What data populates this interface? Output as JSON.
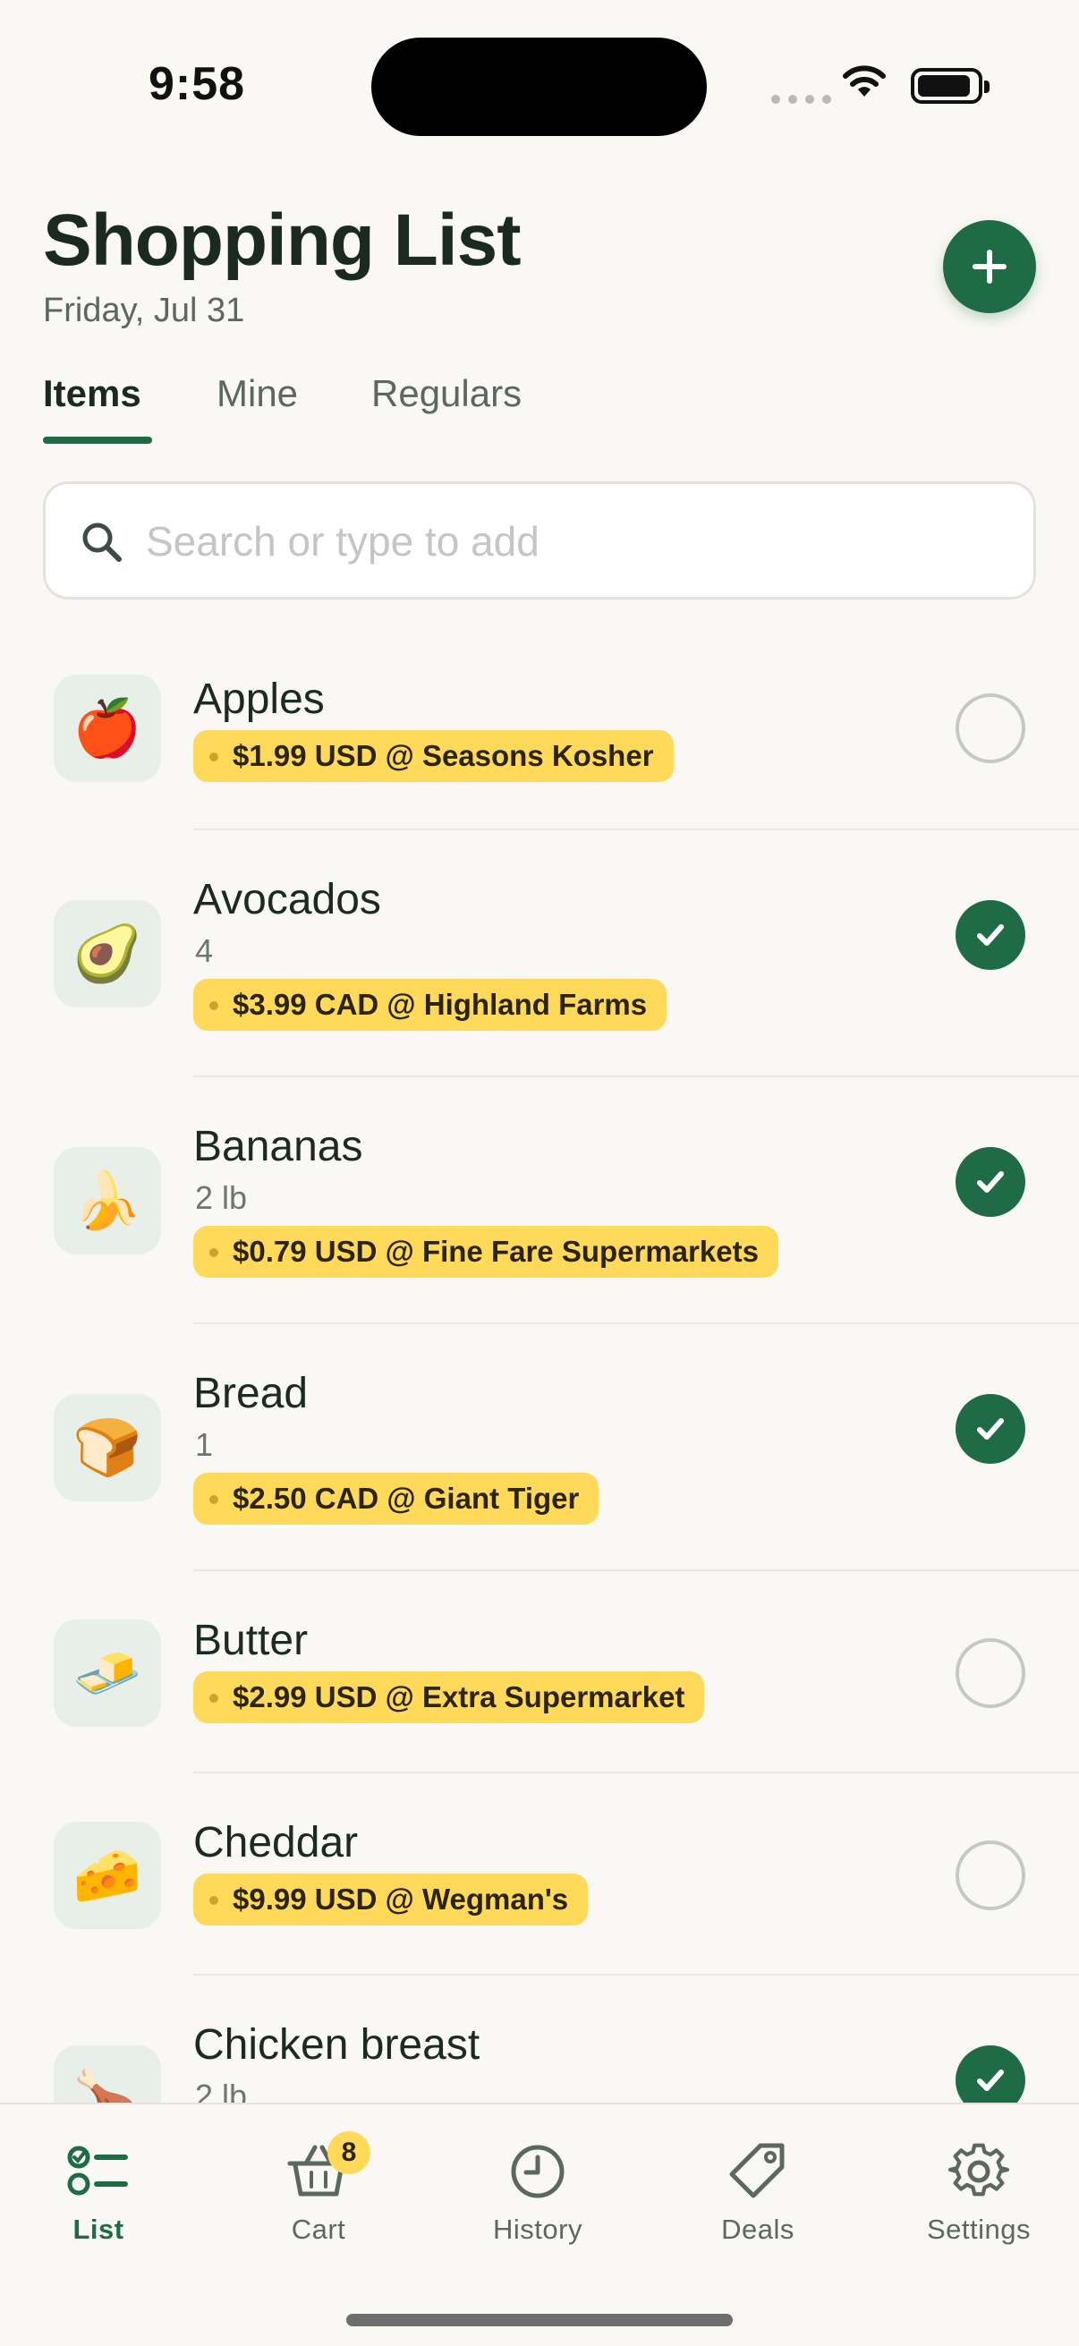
{
  "status": {
    "time": "9:58"
  },
  "header": {
    "title": "Shopping List",
    "date": "Friday, Jul 31"
  },
  "tabs": [
    {
      "label": "Items",
      "active": true
    },
    {
      "label": "Mine",
      "active": false
    },
    {
      "label": "Regulars",
      "active": false
    }
  ],
  "search": {
    "placeholder": "Search or type to add",
    "value": ""
  },
  "items": [
    {
      "name": "Apples",
      "qty": "",
      "price": "$1.99 USD @ Seasons Kosher",
      "checked": false,
      "icon": "apple-icon",
      "glyph": "🍎"
    },
    {
      "name": "Avocados",
      "qty": "4",
      "price": "$3.99 CAD @ Highland Farms",
      "checked": true,
      "icon": "avocado-icon",
      "glyph": "🥑"
    },
    {
      "name": "Bananas",
      "qty": "2 lb",
      "price": "$0.79 USD @ Fine Fare Supermarkets",
      "checked": true,
      "icon": "banana-icon",
      "glyph": "🍌"
    },
    {
      "name": "Bread",
      "qty": "1",
      "price": "$2.50 CAD @ Giant Tiger",
      "checked": true,
      "icon": "bread-icon",
      "glyph": "🍞"
    },
    {
      "name": "Butter",
      "qty": "",
      "price": "$2.99 USD @ Extra Supermarket",
      "checked": false,
      "icon": "butter-icon",
      "glyph": "🧈"
    },
    {
      "name": "Cheddar",
      "qty": "",
      "price": "$9.99 USD @ Wegman's",
      "checked": false,
      "icon": "cheese-icon",
      "glyph": "🧀"
    },
    {
      "name": "Chicken breast",
      "qty": "2 lb",
      "price": "",
      "checked": true,
      "icon": "chicken-leg-icon",
      "glyph": "🍗"
    }
  ],
  "tabbar": [
    {
      "label": "List",
      "icon": "list-check-icon",
      "active": true
    },
    {
      "label": "Cart",
      "icon": "basket-icon",
      "active": false,
      "badge": "8"
    },
    {
      "label": "History",
      "icon": "clock-icon",
      "active": false
    },
    {
      "label": "Deals",
      "icon": "tag-icon",
      "active": false
    },
    {
      "label": "Settings",
      "icon": "gear-icon",
      "active": false
    }
  ],
  "colors": {
    "accent": "#1f6b45",
    "price_tag": "#ffd95a",
    "background": "#faf8f4"
  }
}
